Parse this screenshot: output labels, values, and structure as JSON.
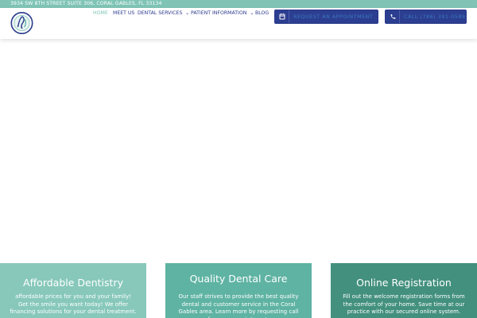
{
  "topbar": {
    "address": "3934 SW 8TH STREET SUITE 306, CORAL GABLES, FL 33134"
  },
  "nav": {
    "items": [
      {
        "label": "HOME",
        "active": true
      },
      {
        "label": "MEET US"
      },
      {
        "label": "DENTAL SERVICES",
        "dropdown": true
      },
      {
        "label": "PATIENT INFORMATION",
        "dropdown": true
      },
      {
        "label": "BLOG"
      }
    ]
  },
  "cta": {
    "appointment_label": "REQUEST AN APPOINTMENT",
    "call_label": "CALL (786) 391-0589",
    "appointment_icon": "calendar-icon",
    "call_icon": "phone-icon"
  },
  "cards": [
    {
      "title": "Affordable Dentistry",
      "text": "affordable prices for you and your family! Get the smile you want today! We offer financing solutions for your dental treatment.",
      "color": "#87c8bb"
    },
    {
      "title": "Quality Dental Care",
      "text": "Our staff strives to provide the best quality dental and customer service in the Coral Gables area.  Learn more by requesting  call for your appointment.",
      "color": "#5fb3a3"
    },
    {
      "title": "Online Registration",
      "text": "Fill out the welcome registration forms from the comfort of your home. Save time at our practice with our secured online system.",
      "color": "#43907e"
    }
  ],
  "colors": {
    "topbar": "#7fc4b5",
    "nav_text": "#2a3a8c",
    "nav_active": "#7fc4b5",
    "button_bg": "#2c3e8f"
  }
}
